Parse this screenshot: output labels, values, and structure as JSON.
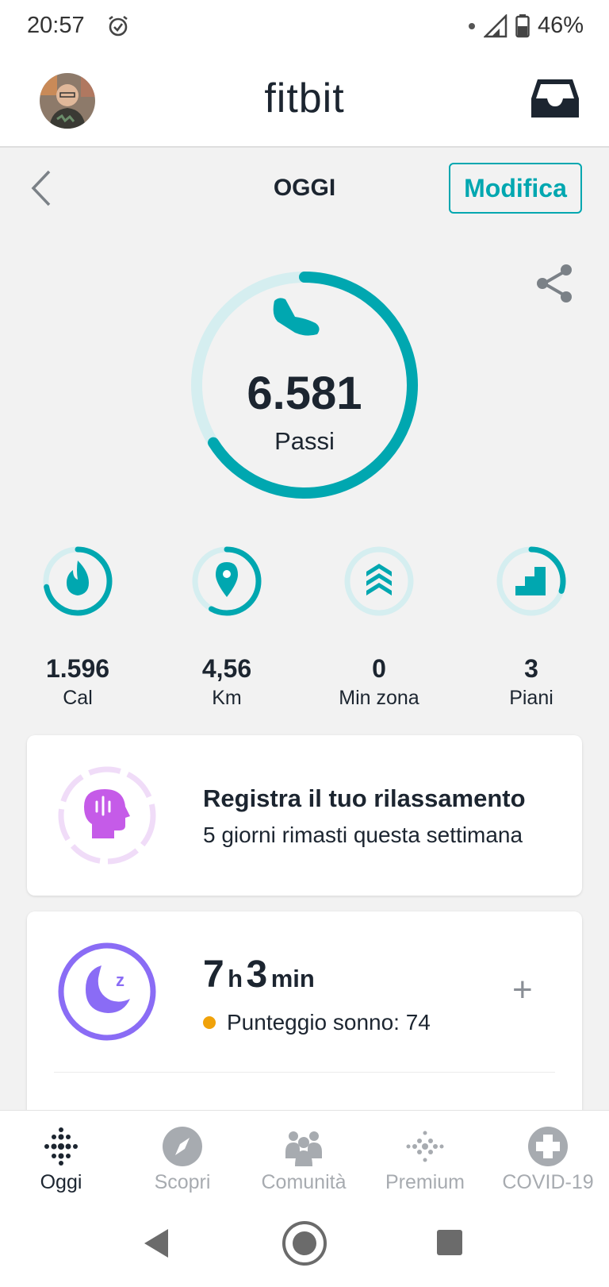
{
  "status_bar": {
    "time": "20:57",
    "battery": "46%"
  },
  "header": {
    "logo": "fitbit"
  },
  "subheader": {
    "title": "OGGI",
    "edit_label": "Modifica"
  },
  "steps": {
    "value": "6.581",
    "label": "Passi",
    "progress": 0.66
  },
  "stats": [
    {
      "value": "1.596",
      "label": "Cal",
      "icon": "flame-icon",
      "progress": 0.72
    },
    {
      "value": "4,56",
      "label": "Km",
      "icon": "location-pin-icon",
      "progress": 0.58
    },
    {
      "value": "0",
      "label": "Min zona",
      "icon": "zone-chevrons-icon",
      "progress": 0
    },
    {
      "value": "3",
      "label": "Piani",
      "icon": "stairs-icon",
      "progress": 0.3
    }
  ],
  "relax_card": {
    "title": "Registra il tuo rilassamento",
    "subtitle": "5 giorni rimasti questa settimana"
  },
  "sleep_card": {
    "hours": "7",
    "hours_unit": "h",
    "minutes": "3",
    "minutes_unit": "min",
    "score": "Punteggio sonno: 74"
  },
  "bottom_nav": [
    {
      "label": "Oggi",
      "active": true
    },
    {
      "label": "Scopri",
      "active": false
    },
    {
      "label": "Comunità",
      "active": false
    },
    {
      "label": "Premium",
      "active": false
    },
    {
      "label": "COVID-19",
      "active": false
    }
  ],
  "colors": {
    "accent": "#00a7b0",
    "accent_light": "#d5eef0",
    "sleep": "#8a6cf5",
    "relax": "#c55be8",
    "score_dot": "#f0a20a"
  }
}
